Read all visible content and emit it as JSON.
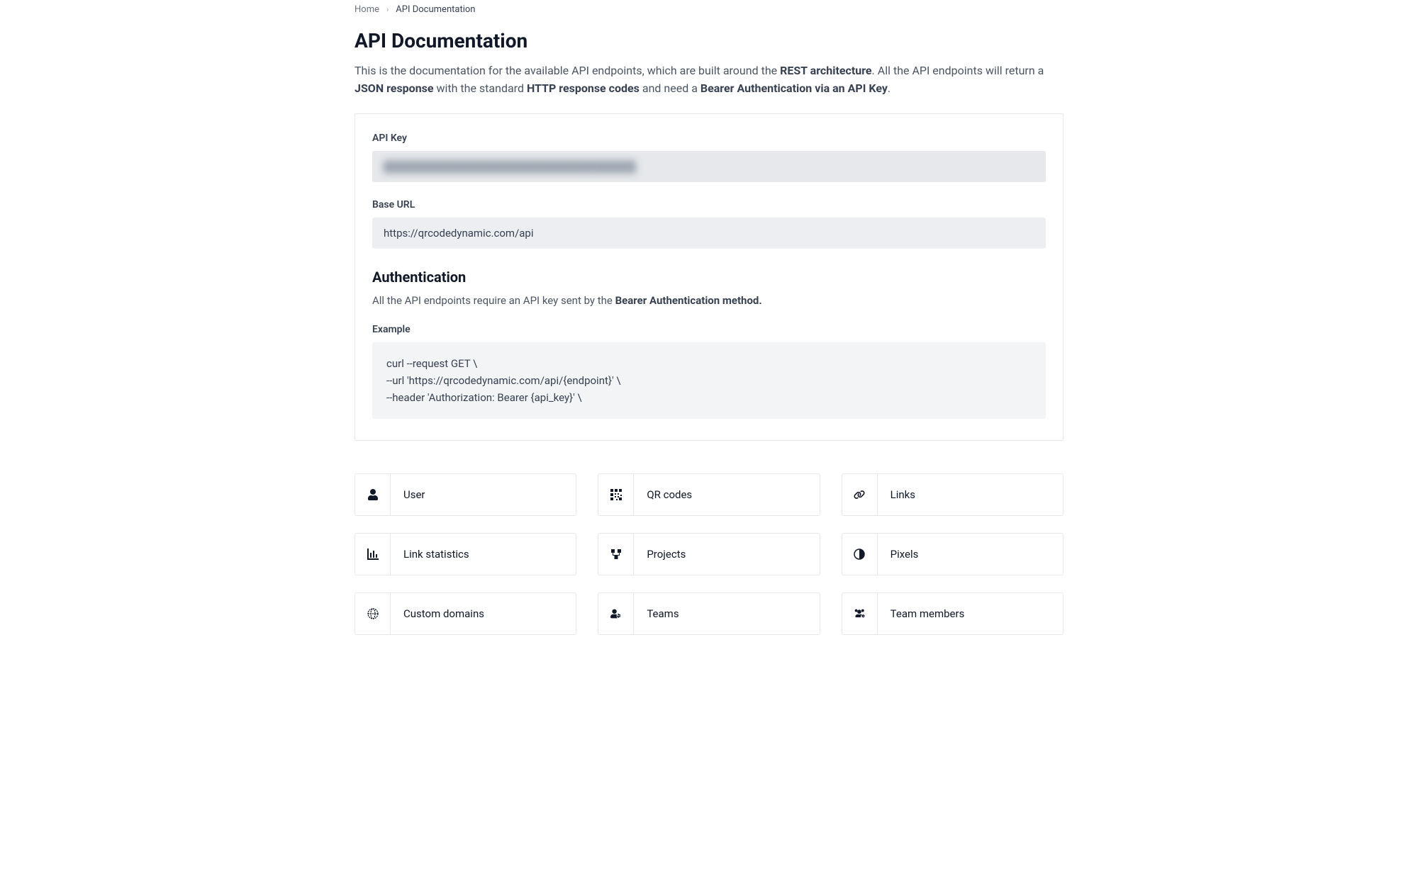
{
  "breadcrumb": {
    "home": "Home",
    "current": "API Documentation"
  },
  "title": "API Documentation",
  "intro": {
    "pre1": "This is the documentation for the available API endpoints, which are built around the ",
    "bold1": "REST architecture",
    "post1": ". All the API endpoints will return a ",
    "bold2": "JSON response",
    "post2": " with the standard ",
    "bold3": "HTTP response codes",
    "post3": " and need a ",
    "bold4": "Bearer Authentication via an API Key",
    "post4": "."
  },
  "panel": {
    "apiKeyLabel": "API Key",
    "apiKeyMasked": "████████████████████████████████",
    "baseUrlLabel": "Base URL",
    "baseUrlValue": "https://qrcodedynamic.com/api",
    "authHeading": "Authentication",
    "authText": "All the API endpoints require an API key sent by the ",
    "authBold": "Bearer Authentication method.",
    "exampleLabel": "Example",
    "exampleCode": "curl --request GET \\\n--url 'https://qrcodedynamic.com/api/{endpoint}' \\\n--header 'Authorization: Bearer {api_key}' \\"
  },
  "cards": [
    {
      "label": "User",
      "icon": "user"
    },
    {
      "label": "QR codes",
      "icon": "qrcode"
    },
    {
      "label": "Links",
      "icon": "link"
    },
    {
      "label": "Link statistics",
      "icon": "chart"
    },
    {
      "label": "Projects",
      "icon": "diagram"
    },
    {
      "label": "Pixels",
      "icon": "halfcircle"
    },
    {
      "label": "Custom domains",
      "icon": "globe"
    },
    {
      "label": "Teams",
      "icon": "usergear"
    },
    {
      "label": "Team members",
      "icon": "usersgear"
    }
  ]
}
